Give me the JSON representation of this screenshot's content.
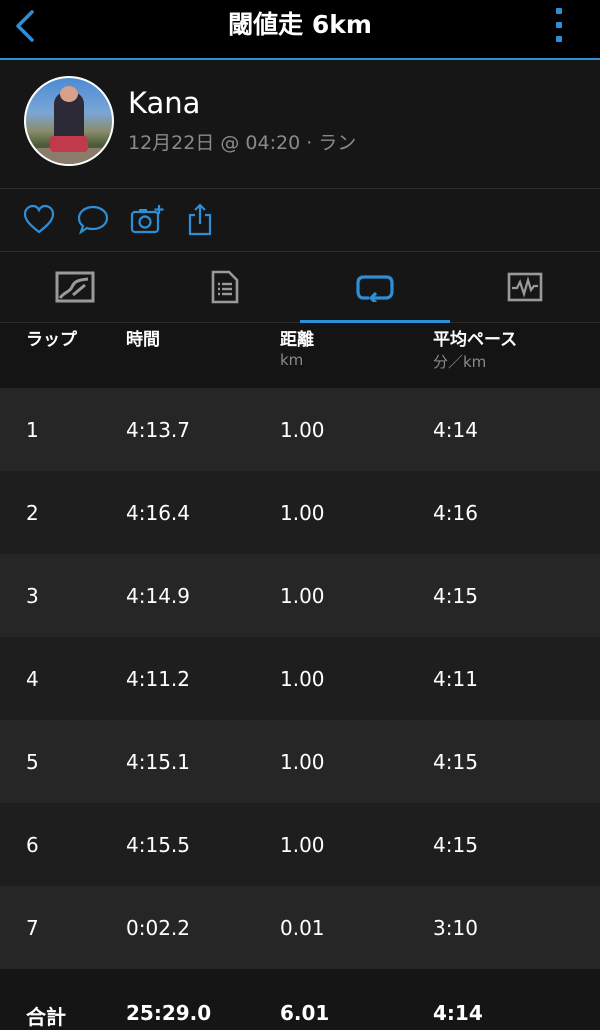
{
  "header": {
    "title": "閾値走 6km",
    "accent_color": "#2e8fd6"
  },
  "profile": {
    "name": "Kana",
    "meta": "12月22日 @ 04:20 · ラン"
  },
  "actions": [
    {
      "icon": "heart-icon"
    },
    {
      "icon": "comment-icon"
    },
    {
      "icon": "add-photo-icon"
    },
    {
      "icon": "share-icon"
    }
  ],
  "tabs": [
    {
      "icon": "map-icon",
      "active": false
    },
    {
      "icon": "details-icon",
      "active": false
    },
    {
      "icon": "laps-icon",
      "active": true
    },
    {
      "icon": "charts-icon",
      "active": false
    }
  ],
  "table": {
    "columns": [
      {
        "label": "ラップ",
        "unit": ""
      },
      {
        "label": "時間",
        "unit": ""
      },
      {
        "label": "距離",
        "unit": "km"
      },
      {
        "label": "平均ペース",
        "unit": "分／km"
      }
    ],
    "rows": [
      {
        "lap": "1",
        "time": "4:13.7",
        "distance": "1.00",
        "pace": "4:14"
      },
      {
        "lap": "2",
        "time": "4:16.4",
        "distance": "1.00",
        "pace": "4:16"
      },
      {
        "lap": "3",
        "time": "4:14.9",
        "distance": "1.00",
        "pace": "4:15"
      },
      {
        "lap": "4",
        "time": "4:11.2",
        "distance": "1.00",
        "pace": "4:11"
      },
      {
        "lap": "5",
        "time": "4:15.1",
        "distance": "1.00",
        "pace": "4:15"
      },
      {
        "lap": "6",
        "time": "4:15.5",
        "distance": "1.00",
        "pace": "4:15"
      },
      {
        "lap": "7",
        "time": "0:02.2",
        "distance": "0.01",
        "pace": "3:10"
      }
    ],
    "total": {
      "label": "合計",
      "time": "25:29.0",
      "distance": "6.01",
      "pace": "4:14"
    },
    "row_colors": [
      "#262626",
      "#1e1e1e"
    ]
  }
}
